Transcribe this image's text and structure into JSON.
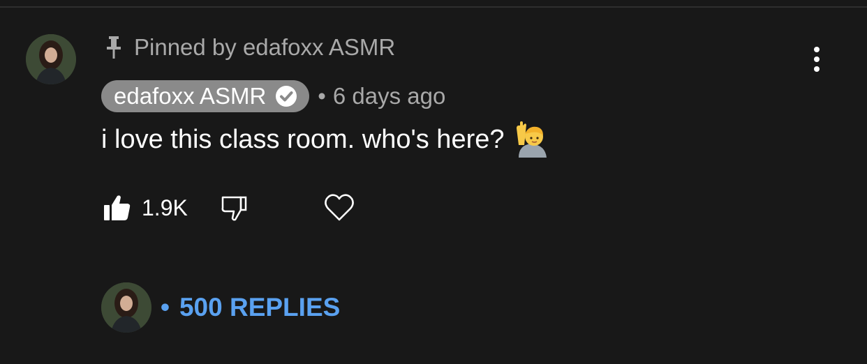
{
  "pinned": {
    "icon": "pin-icon",
    "text": "Pinned by edafoxx ASMR"
  },
  "comment": {
    "author": "edafoxx ASMR",
    "verified_icon": "verified-check-icon",
    "separator": "•",
    "timestamp": "6 days ago",
    "text": "i love this class room. who's here?",
    "emoji_icon": "person-raising-hand-emoji",
    "menu_icon": "more-vertical-icon"
  },
  "actions": {
    "like_icon": "thumbs-up-filled-icon",
    "like_count": "1.9K",
    "dislike_icon": "thumbs-down-outline-icon",
    "heart_icon": "heart-outline-icon"
  },
  "replies": {
    "separator": "•",
    "label": "500 REPLIES"
  },
  "colors": {
    "background": "#181818",
    "chip": "#8a8a8a",
    "muted_text": "#a9a9a9",
    "link_blue": "#5aa1f0"
  }
}
